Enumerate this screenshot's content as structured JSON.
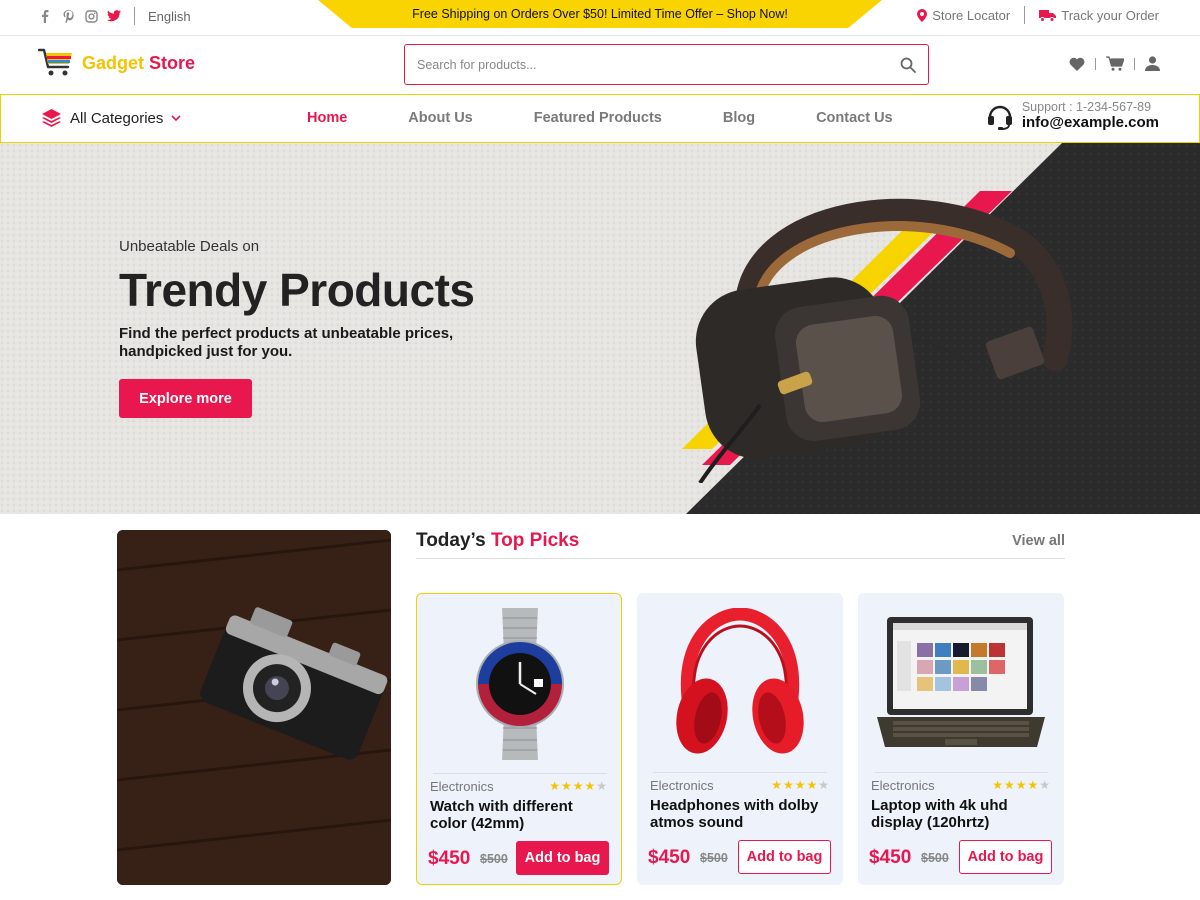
{
  "topbar": {
    "social": [
      "facebook-icon",
      "pinterest-icon",
      "instagram-icon",
      "twitter-icon"
    ],
    "language": "English",
    "promo": "Free Shipping on Orders Over $50! Limited Time Offer – Shop Now!",
    "store_locator": "Store Locator",
    "track_order": "Track your Order"
  },
  "header": {
    "logo_word1": "Gadget",
    "logo_word2": "Store",
    "search_placeholder": "Search for products..."
  },
  "nav": {
    "categories": "All Categories",
    "links": [
      "Home",
      "About Us",
      "Featured Products",
      "Blog",
      "Contact Us"
    ],
    "active": "Home",
    "support_label": "Support : 1-234-567-89",
    "support_email": "info@example.com"
  },
  "hero": {
    "subtitle": "Unbeatable Deals on",
    "title": "Trendy Products",
    "description": "Find the perfect products at unbeatable prices, handpicked just for you.",
    "cta": "Explore more"
  },
  "picks": {
    "title_part1": "Today’s",
    "title_part2": "Top Picks",
    "view_all": "View all",
    "products": [
      {
        "category": "Electronics",
        "name": "Watch with different color (42mm)",
        "price": "$450",
        "old_price": "$500",
        "button": "Add to bag",
        "rating": 4
      },
      {
        "category": "Electronics",
        "name": "Headphones with dolby atmos sound",
        "price": "$450",
        "old_price": "$500",
        "button": "Add to bag",
        "rating": 4
      },
      {
        "category": "Electronics",
        "name": "Laptop with 4k uhd display (120hrtz)",
        "price": "$450",
        "old_price": "$500",
        "button": "Add to bag",
        "rating": 4
      }
    ]
  },
  "colors": {
    "accent": "#e8174d",
    "brand_yellow": "#f9d400"
  }
}
